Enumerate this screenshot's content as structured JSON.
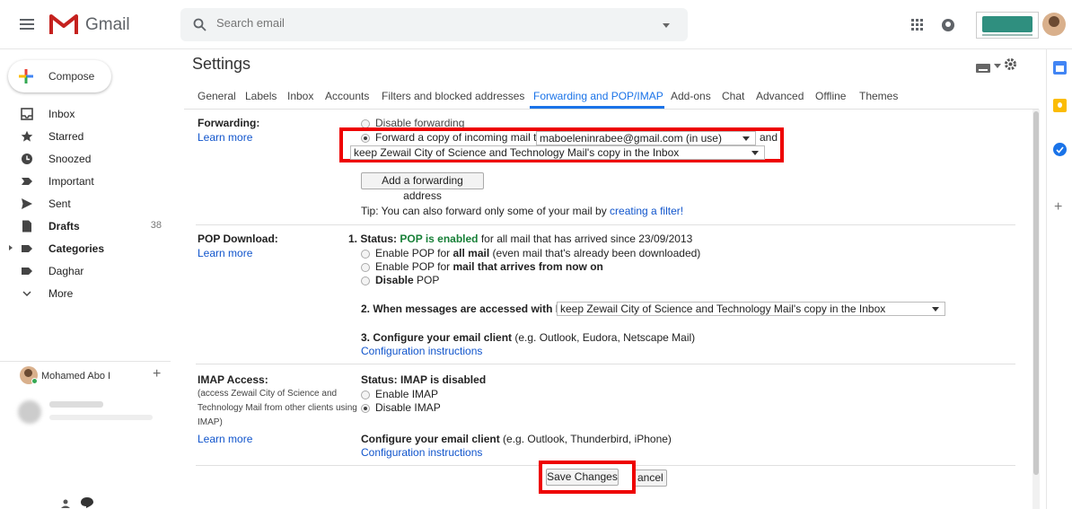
{
  "app": {
    "title": "Gmail"
  },
  "search": {
    "placeholder": "Search email"
  },
  "sidebar": {
    "compose": "Compose",
    "items": [
      {
        "label": "Inbox",
        "count": "",
        "bold": false
      },
      {
        "label": "Starred",
        "count": "",
        "bold": false
      },
      {
        "label": "Snoozed",
        "count": "",
        "bold": false
      },
      {
        "label": "Important",
        "count": "",
        "bold": false
      },
      {
        "label": "Sent",
        "count": "",
        "bold": false
      },
      {
        "label": "Drafts",
        "count": "38",
        "bold": true
      },
      {
        "label": "Categories",
        "count": "",
        "bold": true
      },
      {
        "label": "Daghar",
        "count": "",
        "bold": false
      },
      {
        "label": "More",
        "count": "",
        "bold": false
      }
    ],
    "hangouts_user": "Mohamed Abo I"
  },
  "settings": {
    "title": "Settings",
    "tabs": [
      "General",
      "Labels",
      "Inbox",
      "Accounts",
      "Filters and blocked addresses",
      "Forwarding and POP/IMAP",
      "Add-ons",
      "Chat",
      "Advanced",
      "Offline",
      "Themes"
    ],
    "active_tab": "Forwarding and POP/IMAP",
    "forwarding": {
      "label": "Forwarding:",
      "learn_more": "Learn more",
      "disable": "Disable forwarding",
      "forward_prefix": "Forward a copy of incoming mail to",
      "forward_address": "maboeleninrabee@gmail.com (in use)",
      "and": "and",
      "keep_option": "keep Zewail City of Science and Technology Mail's copy in the Inbox",
      "add_button": "Add a forwarding address",
      "tip_prefix": "Tip: You can also forward only some of your mail by ",
      "tip_link": "creating a filter!"
    },
    "pop": {
      "label": "POP Download:",
      "learn_more": "Learn more",
      "status_prefix": "1. Status: ",
      "status_value": "POP is enabled",
      "status_suffix": " for all mail that has arrived since 23/09/2013",
      "opt1_prefix": "Enable POP for ",
      "opt1_bold": "all mail",
      "opt1_suffix": " (even mail that's already been downloaded)",
      "opt2_prefix": "Enable POP for ",
      "opt2_bold": "mail that arrives from now on",
      "opt3_bold": "Disable",
      "opt3_suffix": " POP",
      "when_label": "2. When messages are accessed with POP",
      "when_value": "keep Zewail City of Science and Technology Mail's copy in the Inbox",
      "configure_bold": "3. Configure your email client",
      "configure_suffix": " (e.g. Outlook, Eudora, Netscape Mail)",
      "config_link": "Configuration instructions"
    },
    "imap": {
      "label": "IMAP Access:",
      "sub1": "(access Zewail City of Science and",
      "sub2": "Technology Mail from other clients using",
      "sub3": "IMAP)",
      "learn_more": "Learn more",
      "status": "Status: IMAP is disabled",
      "enable": "Enable IMAP",
      "disable": "Disable IMAP",
      "configure_bold": "Configure your email client",
      "configure_suffix": " (e.g. Outlook, Thunderbird, iPhone)",
      "config_link": "Configuration instructions"
    },
    "save_button": "Save Changes",
    "cancel_button": "ancel"
  },
  "colors": {
    "accent": "#1a73e8",
    "highlight": "#e00000",
    "link": "#1155cc",
    "enabled": "#188038"
  }
}
